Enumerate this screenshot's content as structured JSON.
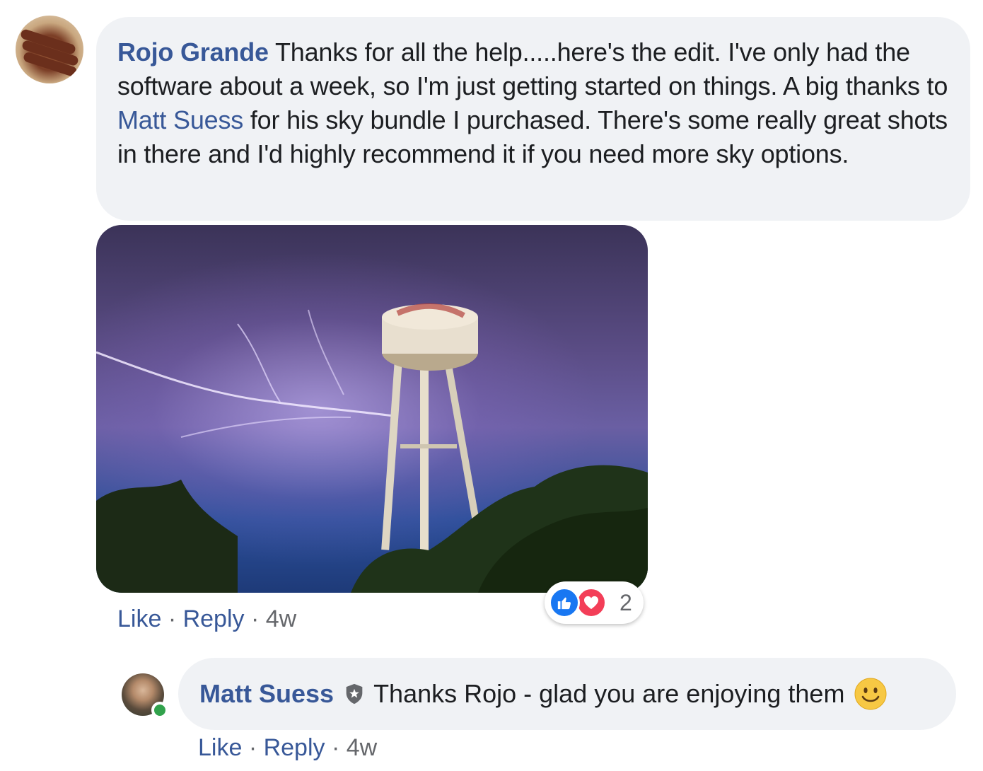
{
  "comment": {
    "author": "Rojo Grande",
    "text_before_mention": " Thanks for all the help.....here's the edit. I've only had the software about a week, so I'm just getting started on things. A big thanks to ",
    "mention": "Matt Suess",
    "text_after_mention": " for his sky bundle I purchased. There's some really great shots in there and I'd highly recommend it if you need more sky options.",
    "image_icon": "photo-water-tower-lightning",
    "actions": {
      "like": "Like",
      "sep": " · ",
      "reply": "Reply",
      "time": "4w"
    },
    "reactions": {
      "icons": [
        "like-icon",
        "love-icon"
      ],
      "count": "2"
    }
  },
  "reply": {
    "author": "Matt Suess",
    "badge_icon": "admin-shield-icon",
    "text": "Thanks Rojo - glad you are enjoying them",
    "emoji_icon": "smiley-icon",
    "online": true,
    "actions": {
      "like": "Like",
      "sep": " · ",
      "reply": "Reply",
      "time": "4w"
    }
  },
  "colors": {
    "link": "#385898",
    "bubble": "#f0f2f5",
    "meta": "#65676b",
    "like": "#1877f2",
    "love": "#f33e58",
    "online": "#31a24c"
  }
}
